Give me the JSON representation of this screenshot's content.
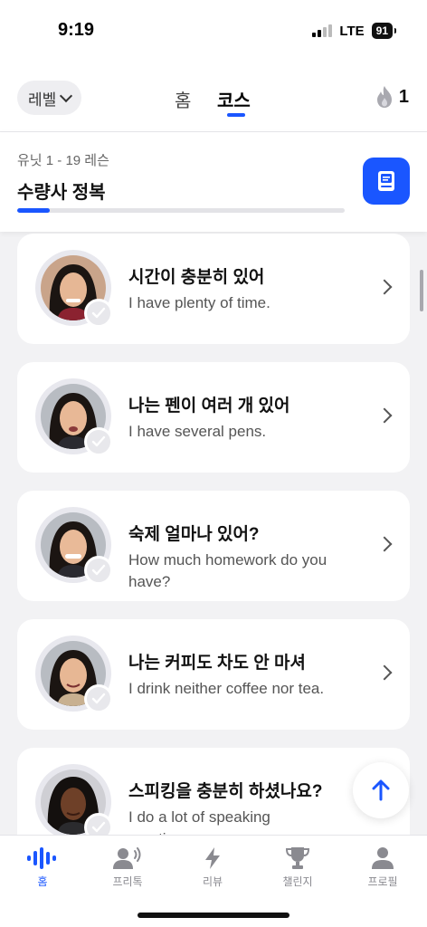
{
  "status": {
    "time": "9:19",
    "network": "LTE",
    "battery": "91"
  },
  "nav": {
    "level_label": "레벨",
    "tabs": [
      {
        "label": "홈"
      },
      {
        "label": "코스"
      }
    ],
    "active_tab": "코스",
    "streak": "1"
  },
  "unit": {
    "subtitle": "유닛 1 - 19 레슨",
    "title": "수량사 정복",
    "progress_percent": 10
  },
  "lessons": [
    {
      "title": "시간이 충분히 있어",
      "translation": "I have plenty of time.",
      "completed": true
    },
    {
      "title": "나는 펜이 여러 개 있어",
      "translation": "I have several pens.",
      "completed": true
    },
    {
      "title": "숙제 얼마나 있어?",
      "translation": "How much homework do you have?",
      "completed": true
    },
    {
      "title": "나는 커피도 차도 안 마셔",
      "translation": "I drink neither coffee nor tea.",
      "completed": true
    },
    {
      "title": "스피킹을 충분히 하셨나요?",
      "translation": "I do a lot of speaking practice.",
      "completed": true
    }
  ],
  "bottom_nav": [
    {
      "label": "홈",
      "icon": "waveform-icon",
      "active": true
    },
    {
      "label": "프리톡",
      "icon": "speaking-person-icon",
      "active": false
    },
    {
      "label": "리뷰",
      "icon": "lightning-icon",
      "active": false
    },
    {
      "label": "챌린지",
      "icon": "trophy-icon",
      "active": false
    },
    {
      "label": "프로필",
      "icon": "person-icon",
      "active": false
    }
  ],
  "colors": {
    "accent": "#1a56ff",
    "background": "#f2f2f4"
  }
}
